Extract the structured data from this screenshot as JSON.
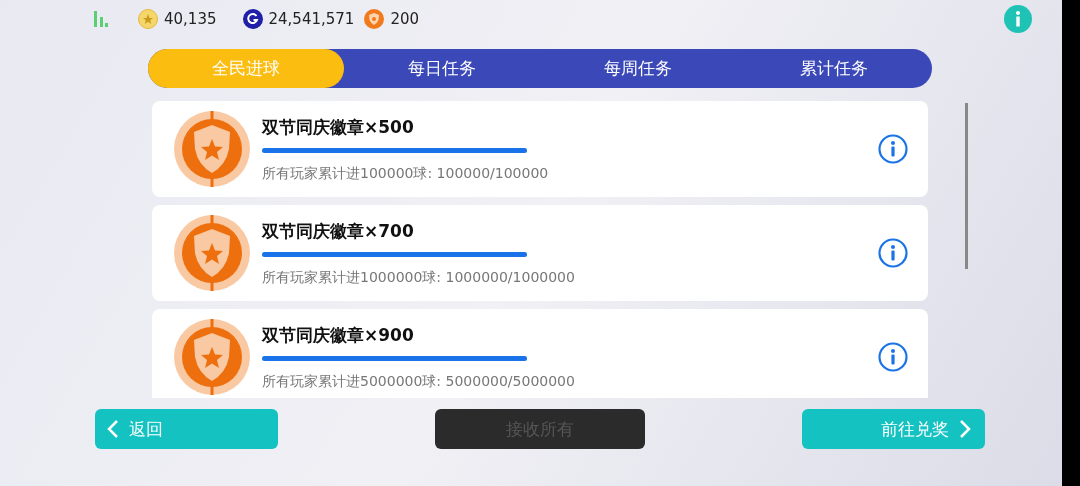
{
  "currencies": [
    {
      "kind": "star",
      "amount": "40,135"
    },
    {
      "kind": "g",
      "amount": "24,541,571"
    },
    {
      "kind": "shield",
      "amount": "200"
    }
  ],
  "tabs": [
    {
      "label": "全民进球",
      "selected": true
    },
    {
      "label": "每日任务",
      "selected": false
    },
    {
      "label": "每周任务",
      "selected": false
    },
    {
      "label": "累计任务",
      "selected": false
    }
  ],
  "tasks": [
    {
      "title": "双节同庆徽章×500",
      "level": 1,
      "progress": "所有玩家累计进100000球: 100000/100000"
    },
    {
      "title": "双节同庆徽章×700",
      "level": 1,
      "progress": "所有玩家累计进1000000球: 1000000/1000000"
    },
    {
      "title": "双节同庆徽章×900",
      "level": 1,
      "progress": "所有玩家累计进5000000球: 5000000/5000000"
    }
  ],
  "buttons": [
    {
      "kind": "back",
      "label": "返回",
      "disabled": false
    },
    {
      "kind": "plain",
      "label": "接收所有",
      "disabled": true
    },
    {
      "kind": "forward",
      "label": "前往兑奖",
      "disabled": false
    }
  ]
}
